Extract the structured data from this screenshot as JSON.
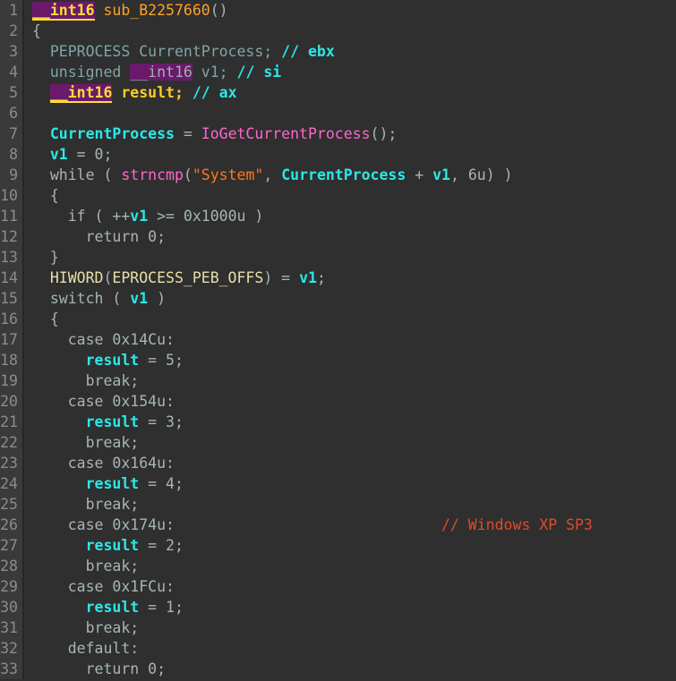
{
  "editor": {
    "name": "decompiler-pseudocode-view",
    "background_color": "#2f2f2f",
    "gutter_color": "#3a3a3a",
    "line_number_color": "#8c8c8c",
    "total_lines": 33,
    "function_name": "sub_B2257660",
    "return_type": "__int16"
  },
  "palette": {
    "plain": "#a8b5b5",
    "type": "#7fa5a5",
    "function": "#ff66cc",
    "subname": "#ffa028",
    "variable": "#29e8e8",
    "string": "#ff7820",
    "comment": "#e04a28",
    "macro": "#e8dfa8",
    "highlight_bg": "#6b1a6b",
    "highlight_fg": "#ffdd33"
  },
  "lines": [
    {
      "n": "1",
      "text": "__int16 sub_B2257660()"
    },
    {
      "n": "2",
      "text": "{"
    },
    {
      "n": "3",
      "text": "  PEPROCESS CurrentProcess; // ebx"
    },
    {
      "n": "4",
      "text": "  unsigned __int16 v1; // si"
    },
    {
      "n": "5",
      "text": "  __int16 result; // ax"
    },
    {
      "n": "6",
      "text": ""
    },
    {
      "n": "7",
      "text": "  CurrentProcess = IoGetCurrentProcess();"
    },
    {
      "n": "8",
      "text": "  v1 = 0;"
    },
    {
      "n": "9",
      "text": "  while ( strncmp(\"System\", CurrentProcess + v1, 6u) )"
    },
    {
      "n": "10",
      "text": "  {"
    },
    {
      "n": "11",
      "text": "    if ( ++v1 >= 0x1000u )"
    },
    {
      "n": "12",
      "text": "      return 0;"
    },
    {
      "n": "13",
      "text": "  }"
    },
    {
      "n": "14",
      "text": "  HIWORD(EPROCESS_PEB_OFFS) = v1;"
    },
    {
      "n": "15",
      "text": "  switch ( v1 )"
    },
    {
      "n": "16",
      "text": "  {"
    },
    {
      "n": "17",
      "text": "    case 0x14Cu:"
    },
    {
      "n": "18",
      "text": "      result = 5;"
    },
    {
      "n": "19",
      "text": "      break;"
    },
    {
      "n": "20",
      "text": "    case 0x154u:"
    },
    {
      "n": "21",
      "text": "      result = 3;"
    },
    {
      "n": "22",
      "text": "      break;"
    },
    {
      "n": "23",
      "text": "    case 0x164u:"
    },
    {
      "n": "24",
      "text": "      result = 4;"
    },
    {
      "n": "25",
      "text": "      break;"
    },
    {
      "n": "26",
      "text": "    case 0x174u:                              // Windows XP SP3"
    },
    {
      "n": "27",
      "text": "      result = 2;"
    },
    {
      "n": "28",
      "text": "      break;"
    },
    {
      "n": "29",
      "text": "    case 0x1FCu:"
    },
    {
      "n": "30",
      "text": "      result = 1;"
    },
    {
      "n": "31",
      "text": "      break;"
    },
    {
      "n": "32",
      "text": "    default:"
    },
    {
      "n": "33",
      "text": "      return 0;"
    }
  ],
  "tokens": {
    "l1": {
      "type": "__int16",
      "fn": "sub_B2257660",
      "parens": "()"
    },
    "l2": {
      "brace": "{"
    },
    "l3": {
      "type": "PEPROCESS",
      "var": "CurrentProcess",
      "semi": ";",
      "comment": "// ebx"
    },
    "l4": {
      "unsigned": "unsigned",
      "type": "__int16",
      "var": "v1",
      "semi": ";",
      "comment": "// si"
    },
    "l5": {
      "type": "__int16",
      "var": "result",
      "semi": ";",
      "comment": "// ax"
    },
    "l7": {
      "lhs": "CurrentProcess",
      "eq": " = ",
      "fn": "IoGetCurrentProcess",
      "tail": "();"
    },
    "l8": {
      "lhs": "v1",
      "rhs": " = 0;"
    },
    "l9": {
      "kw": "while ( ",
      "fn": "strncmp",
      "open": "(",
      "str": "\"System\"",
      "comma": ", ",
      "var": "CurrentProcess",
      "plus": " + ",
      "var2": "v1",
      "args": ", 6u) )"
    },
    "l10": {
      "brace": "{"
    },
    "l11": {
      "kw": "if ( ++",
      "var": "v1",
      "cond": " >= 0x1000u )"
    },
    "l12": {
      "kw": "return 0;"
    },
    "l13": {
      "brace": "}"
    },
    "l14": {
      "macro": "HIWORD",
      "open": "(",
      "const": "EPROCESS_PEB_OFFS",
      "close": ")",
      "eq": " = ",
      "var": "v1",
      "semi": ";"
    },
    "l15": {
      "kw": "switch ( ",
      "var": "v1",
      "close": " )"
    },
    "l16": {
      "brace": "{"
    },
    "l17": {
      "kw": "case 0x14Cu:"
    },
    "l18": {
      "var": "result",
      "rhs": " = 5;"
    },
    "l19": {
      "kw": "break;"
    },
    "l20": {
      "kw": "case 0x154u:"
    },
    "l21": {
      "var": "result",
      "rhs": " = 3;"
    },
    "l22": {
      "kw": "break;"
    },
    "l23": {
      "kw": "case 0x164u:"
    },
    "l24": {
      "var": "result",
      "rhs": " = 4;"
    },
    "l25": {
      "kw": "break;"
    },
    "l26": {
      "kw": "case 0x174u:",
      "comment": "// Windows XP SP3"
    },
    "l27": {
      "var": "result",
      "rhs": " = 2;"
    },
    "l28": {
      "kw": "break;"
    },
    "l29": {
      "kw": "case 0x1FCu:"
    },
    "l30": {
      "var": "result",
      "rhs": " = 1;"
    },
    "l31": {
      "kw": "break;"
    },
    "l32": {
      "kw": "default:"
    },
    "l33": {
      "kw": "return 0;"
    }
  }
}
